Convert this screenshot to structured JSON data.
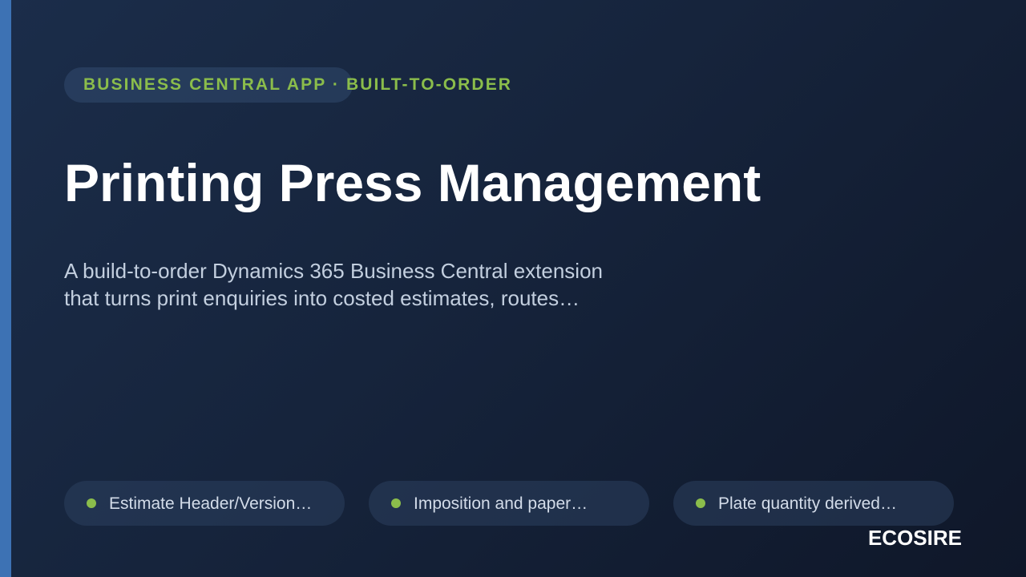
{
  "tag": "BUSINESS CENTRAL APP · BUILT-TO-ORDER",
  "title": "Printing Press Management",
  "subtitle": {
    "line1": "A build-to-order Dynamics 365 Business Central extension",
    "line2": "that turns print enquiries into costed estimates, routes…"
  },
  "features": [
    {
      "label": "Estimate Header/Version…"
    },
    {
      "label": "Imposition and paper…"
    },
    {
      "label": "Plate quantity derived…"
    }
  ],
  "brand": "ECOSIRE",
  "colors": {
    "accent_bar": "#3d72b4",
    "tag_green": "#8bbd4b",
    "bullet_green": "#8bbd4b",
    "title": "#ffffff",
    "subtitle": "#c3cfdf",
    "background_start": "#1b2d4a",
    "background_end": "#0f1729"
  }
}
